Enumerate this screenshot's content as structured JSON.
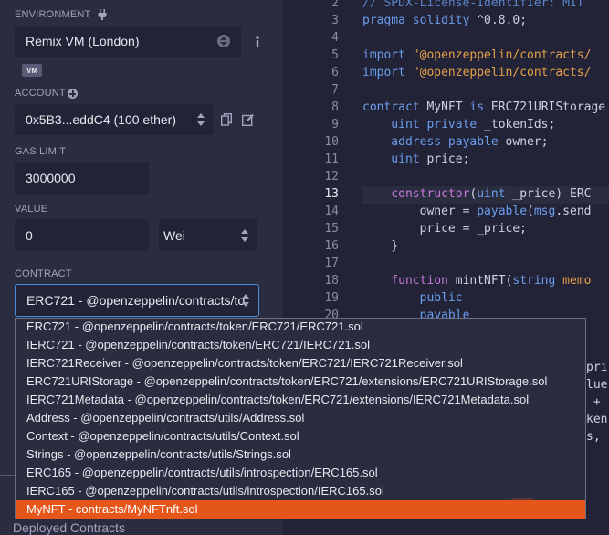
{
  "environment": {
    "label": "ENVIRONMENT",
    "value": "Remix VM (London)",
    "badge": "VM"
  },
  "account": {
    "label": "ACCOUNT",
    "value": "0x5B3...eddC4 (100 ether)"
  },
  "gas_limit": {
    "label": "GAS LIMIT",
    "value": "3000000"
  },
  "value": {
    "label": "VALUE",
    "amount": "0",
    "unit": "Wei"
  },
  "contract": {
    "label": "CONTRACT",
    "selected": "ERC721 - @openzeppelin/contracts/to",
    "options": [
      "ERC721 - @openzeppelin/contracts/token/ERC721/ERC721.sol",
      "IERC721 - @openzeppelin/contracts/token/ERC721/IERC721.sol",
      "IERC721Receiver - @openzeppelin/contracts/token/ERC721/IERC721Receiver.sol",
      "ERC721URIStorage - @openzeppelin/contracts/token/ERC721/extensions/ERC721URIStorage.sol",
      "IERC721Metadata - @openzeppelin/contracts/token/ERC721/extensions/IERC721Metadata.sol",
      "Address - @openzeppelin/contracts/utils/Address.sol",
      "Context - @openzeppelin/contracts/utils/Context.sol",
      "Strings - @openzeppelin/contracts/utils/Strings.sol",
      "ERC165 - @openzeppelin/contracts/utils/introspection/ERC165.sol",
      "IERC165 - @openzeppelin/contracts/utils/introspection/IERC165.sol",
      "MyNFT - contracts/MyNFTnft.sol"
    ],
    "highlighted_index": 10
  },
  "deployed_label": "Deployed Contracts",
  "editor": {
    "active_line": "13",
    "line_numbers": [
      "2",
      "3",
      "4",
      "5",
      "6",
      "7",
      "8",
      "9",
      "10",
      "11",
      "12",
      "13",
      "14",
      "15",
      "16",
      "17",
      "18",
      "19",
      "20"
    ],
    "lines": {
      "l2": "// SPDX-License-Identifier: MIT",
      "l3a": "pragma solidity",
      "l3b": " ^0.8.0;",
      "l5a": "import",
      "l5b": " \"@openzeppelin/contracts/",
      "l6a": "import",
      "l6b": " \"@openzeppelin/contracts/",
      "l8a": "contract",
      "l8b": " MyNFT ",
      "l8c": "is",
      "l8d": " ERC721URIStorage",
      "l9a": "    uint private",
      "l9b": " _tokenIds;",
      "l10a": "    address payable",
      "l10b": " owner;",
      "l11a": "    uint",
      "l11b": " price;",
      "l13a": "    constructor",
      "l13b": "(",
      "l13c": "uint",
      "l13d": " _price) ERC",
      "l14a": "        owner = ",
      "l14b": "payable",
      "l14c": "(",
      "l14d": "msg",
      "l14e": ".send",
      "l15": "        price = _price;",
      "l16": "    }",
      "l18a": "    function",
      "l18b": " mintNFT(",
      "l18c": "string",
      "l18d": " memo",
      "l19": "        public",
      "l20": "        payable",
      "r1": "pri",
      "r2": "lue",
      "r3": " +",
      "r4": "ken",
      "r5": "s,"
    }
  }
}
